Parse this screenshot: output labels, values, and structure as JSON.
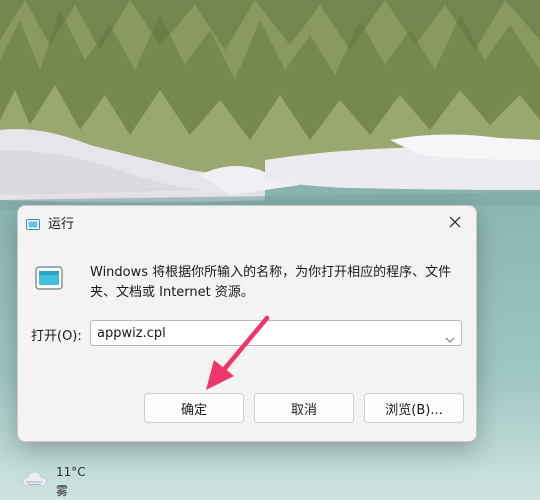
{
  "dialog": {
    "title": "运行",
    "description": "Windows 将根据你所输入的名称，为你打开相应的程序、文件夹、文档或 Internet 资源。",
    "open_label": "打开(O):",
    "command_value": "appwiz.cpl",
    "ok_label": "确定",
    "cancel_label": "取消",
    "browse_label": "浏览(B)..."
  },
  "annotation": {
    "arrow_color": "#f0356b"
  },
  "weather": {
    "temperature": "11°C",
    "condition": "雾"
  }
}
